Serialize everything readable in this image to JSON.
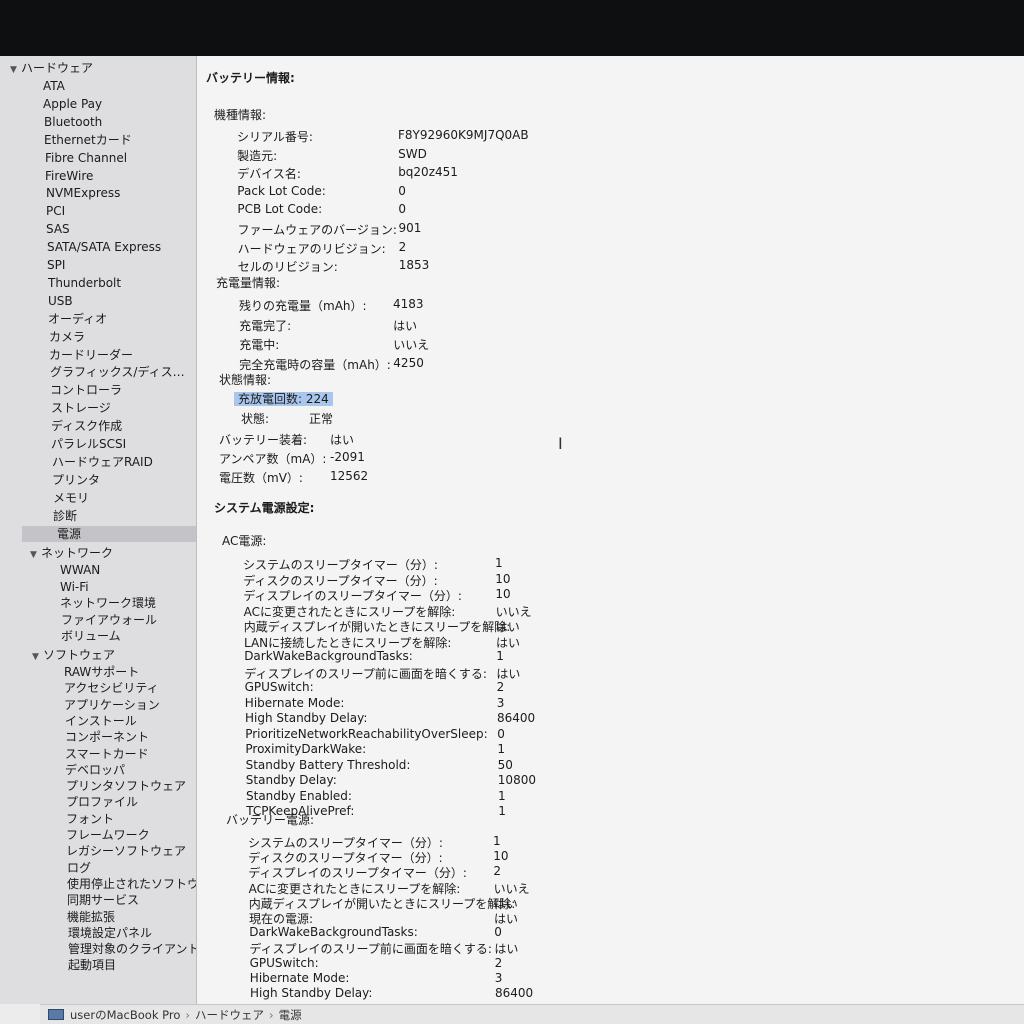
{
  "sidebar": {
    "groups": [
      {
        "label": "ハードウェア",
        "items": [
          "ATA",
          "Apple Pay",
          "Bluetooth",
          "Ethernetカード",
          "Fibre Channel",
          "FireWire",
          "NVMExpress",
          "PCI",
          "SAS",
          "SATA/SATA Express",
          "SPI",
          "Thunderbolt",
          "USB",
          "オーディオ",
          "カメラ",
          "カードリーダー",
          "グラフィックス/ディス…",
          "コントローラ",
          "ストレージ",
          "ディスク作成",
          "パラレルSCSI",
          "ハードウェアRAID",
          "プリンタ",
          "メモリ",
          "診断",
          "電源"
        ]
      },
      {
        "label": "ネットワーク",
        "items": [
          "WWAN",
          "Wi-Fi",
          "ネットワーク環境",
          "ファイアウォール",
          "ボリューム"
        ]
      },
      {
        "label": "ソフトウェア",
        "items": [
          "RAWサポート",
          "アクセシビリティ",
          "アプリケーション",
          "インストール",
          "コンポーネント",
          "スマートカード",
          "デベロッパ",
          "プリンタソフトウェア",
          "プロファイル",
          "フォント",
          "フレームワーク",
          "レガシーソフトウェア",
          "ログ",
          "使用停止されたソフトウ…",
          "同期サービス",
          "機能拡張",
          "環境設定パネル",
          "管理対象のクライアント",
          "起動項目"
        ]
      }
    ],
    "selected": "電源"
  },
  "battery": {
    "title": "バッテリー情報:",
    "model_title": "機種情報:",
    "model": [
      {
        "label": "シリアル番号:",
        "value": "F8Y92960K9MJ7Q0AB"
      },
      {
        "label": "製造元:",
        "value": "SWD"
      },
      {
        "label": "デバイス名:",
        "value": "bq20z451"
      },
      {
        "label": "Pack Lot Code:",
        "value": "0"
      },
      {
        "label": "PCB Lot Code:",
        "value": "0"
      },
      {
        "label": "ファームウェアのバージョン:",
        "value": "901"
      },
      {
        "label": "ハードウェアのリビジョン:",
        "value": "2"
      },
      {
        "label": "セルのリビジョン:",
        "value": "1853"
      }
    ],
    "charge_title": "充電量情報:",
    "charge": [
      {
        "label": "残りの充電量（mAh）:",
        "value": "4183"
      },
      {
        "label": "充電完了:",
        "value": "はい"
      },
      {
        "label": "充電中:",
        "value": "いいえ"
      },
      {
        "label": "完全充電時の容量（mAh）:",
        "value": "4250"
      }
    ],
    "health_title": "状態情報:",
    "cycle_label": "充放電回数:",
    "cycle_value": "224",
    "condition_label": "状態:",
    "condition_value": "正常",
    "misc": [
      {
        "label": "バッテリー装着:",
        "value": "はい"
      },
      {
        "label": "アンペア数（mA）:",
        "value": "-2091"
      },
      {
        "label": "電圧数（mV）:",
        "value": "12562"
      }
    ]
  },
  "power": {
    "title": "システム電源設定:",
    "ac_title": "AC電源:",
    "ac": [
      {
        "label": "システムのスリープタイマー（分）:",
        "value": "1"
      },
      {
        "label": "ディスクのスリープタイマー（分）:",
        "value": "10"
      },
      {
        "label": "ディスプレイのスリープタイマー（分）:",
        "value": "10"
      },
      {
        "label": "ACに変更されたときにスリープを解除:",
        "value": "いいえ"
      },
      {
        "label": "内蔵ディスプレイが開いたときにスリープを解除:",
        "value": "はい"
      },
      {
        "label": "LANに接続したときにスリープを解除:",
        "value": "はい"
      },
      {
        "label": "DarkWakeBackgroundTasks:",
        "value": "1"
      },
      {
        "label": "ディスプレイのスリープ前に画面を暗くする:",
        "value": "はい"
      },
      {
        "label": "GPUSwitch:",
        "value": "2"
      },
      {
        "label": "Hibernate Mode:",
        "value": "3"
      },
      {
        "label": "High Standby Delay:",
        "value": "86400"
      },
      {
        "label": "PrioritizeNetworkReachabilityOverSleep:",
        "value": "0"
      },
      {
        "label": "ProximityDarkWake:",
        "value": "1"
      },
      {
        "label": "Standby Battery Threshold:",
        "value": "50"
      },
      {
        "label": "Standby Delay:",
        "value": "10800"
      },
      {
        "label": "Standby Enabled:",
        "value": "1"
      },
      {
        "label": "TCPKeepAlivePref:",
        "value": "1"
      }
    ],
    "battery_title": "バッテリー電源:",
    "battery": [
      {
        "label": "システムのスリープタイマー（分）:",
        "value": "1"
      },
      {
        "label": "ディスクのスリープタイマー（分）:",
        "value": "10"
      },
      {
        "label": "ディスプレイのスリープタイマー（分）:",
        "value": "2"
      },
      {
        "label": "ACに変更されたときにスリープを解除:",
        "value": "いいえ"
      },
      {
        "label": "内蔵ディスプレイが開いたときにスリープを解除:",
        "value": "はい"
      },
      {
        "label": "現在の電源:",
        "value": "はい"
      },
      {
        "label": "DarkWakeBackgroundTasks:",
        "value": "0"
      },
      {
        "label": "ディスプレイのスリープ前に画面を暗くする:",
        "value": "はい"
      },
      {
        "label": "GPUSwitch:",
        "value": "2"
      },
      {
        "label": "Hibernate Mode:",
        "value": "3"
      },
      {
        "label": "High Standby Delay:",
        "value": "86400"
      }
    ]
  },
  "statusbar": {
    "computer": "userのMacBook Pro",
    "sep": "›",
    "section": "ハードウェア",
    "item": "電源"
  }
}
